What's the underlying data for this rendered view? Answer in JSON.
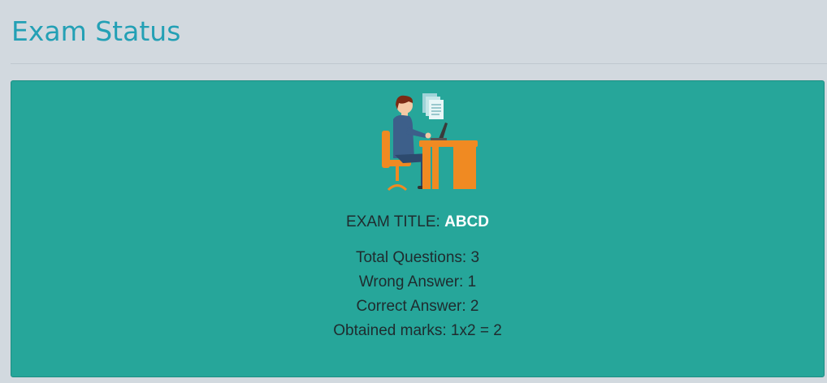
{
  "page": {
    "title": "Exam Status"
  },
  "exam": {
    "title_label": "EXAM TITLE:",
    "title_value": "ABCD"
  },
  "stats": {
    "total_questions": "Total Questions: 3",
    "wrong_answer": "Wrong Answer: 1",
    "correct_answer": "Correct Answer: 2",
    "obtained_marks": "Obtained marks: 1x2 = 2"
  },
  "colors": {
    "page_background": "#d2d9df",
    "title_color": "#23a0b5",
    "card_background": "#26a69a",
    "highlight_text": "#ffffff"
  },
  "icons": {
    "illustration": "person-at-desk-with-laptop-illustration"
  }
}
